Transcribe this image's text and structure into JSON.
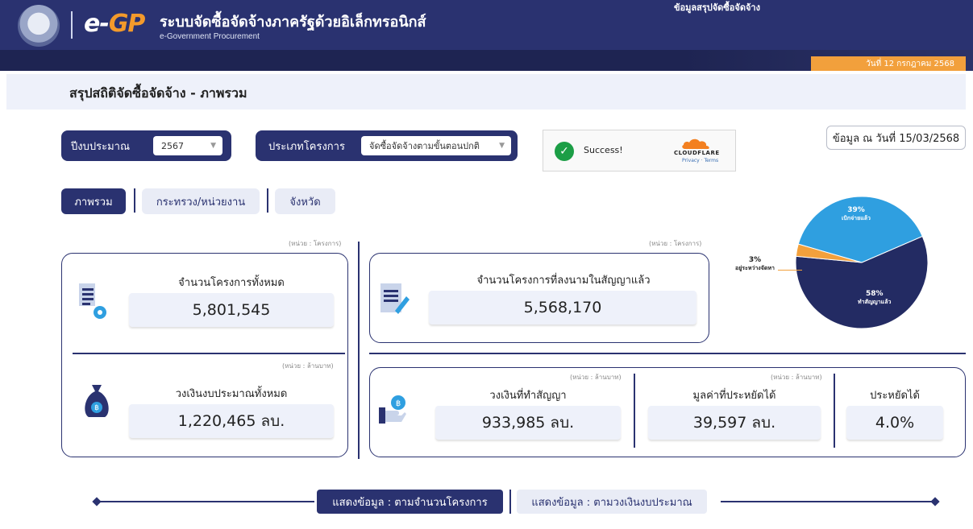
{
  "header": {
    "logo_e": "e-",
    "logo_gp": "GP",
    "title": "ระบบจัดซื้อจัดจ้างภาครัฐด้วยอิเล็กทรอนิกส์",
    "subtitle": "e-Government Procurement",
    "top_text": "ข้อมูลสรุปจัดซื้อจัดจ้าง"
  },
  "date_bar": {
    "date": "วันที่ 12 กรกฎาคม 2568"
  },
  "page": {
    "title": "สรุปสถิติจัดซื้อจัดจ้าง - ภาพรวม"
  },
  "filters": {
    "budget_year_label": "ปีงบประมาณ",
    "budget_year_value": "2567",
    "project_type_label": "ประเภทโครงการ",
    "project_type_value": "จัดซื้อจัดจ้างตามขั้นตอนปกติ"
  },
  "captcha": {
    "status": "Success!",
    "brand": "CLOUDFLARE",
    "links": "Privacy · Terms"
  },
  "as_of": "ข้อมูล ณ วันที่ 15/03/2568",
  "tabs": [
    {
      "label": "ภาพรวม"
    },
    {
      "label": "กระทรวง/หน่วยงาน"
    },
    {
      "label": "จังหวัด"
    }
  ],
  "units": {
    "projects": "(หน่วย : โครงการ)",
    "million_baht": "(หน่วย : ล้านบาท)"
  },
  "stats": {
    "total_projects_label": "จำนวนโครงการทั้งหมด",
    "total_projects_value": "5,801,545",
    "signed_projects_label": "จำนวนโครงการที่ลงนามในสัญญาแล้ว",
    "signed_projects_value": "5,568,170",
    "total_budget_label": "วงเงินงบประมาณทั้งหมด",
    "total_budget_value": "1,220,465 ลบ.",
    "contract_value_label": "วงเงินที่ทำสัญญา",
    "contract_value_value": "933,985 ลบ.",
    "savings_label": "มูลค่าที่ประหยัดได้",
    "savings_value": "39,597 ลบ.",
    "savings_pct_label": "ประหยัดได้",
    "savings_pct_value": "4.0%"
  },
  "pie": {
    "slices": [
      {
        "label": "ทำสัญญาแล้ว",
        "pct_text": "58%",
        "value": 58,
        "color": "#232b63"
      },
      {
        "label": "เบิกจ่ายแล้ว",
        "pct_text": "39%",
        "value": 39,
        "color": "#2f9fe0"
      },
      {
        "label": "อยู่ระหว่างจัดหา",
        "pct_text": "3%",
        "value": 3,
        "color": "#f2a03c"
      }
    ]
  },
  "bottom": {
    "by_projects": "แสดงข้อมูล : ตามจำนวนโครงการ",
    "by_budget": "แสดงข้อมูล : ตามวงเงินงบประมาณ"
  },
  "colors": {
    "navy": "#2a3270",
    "orange": "#f2a03c",
    "sky": "#2f9fe0"
  }
}
